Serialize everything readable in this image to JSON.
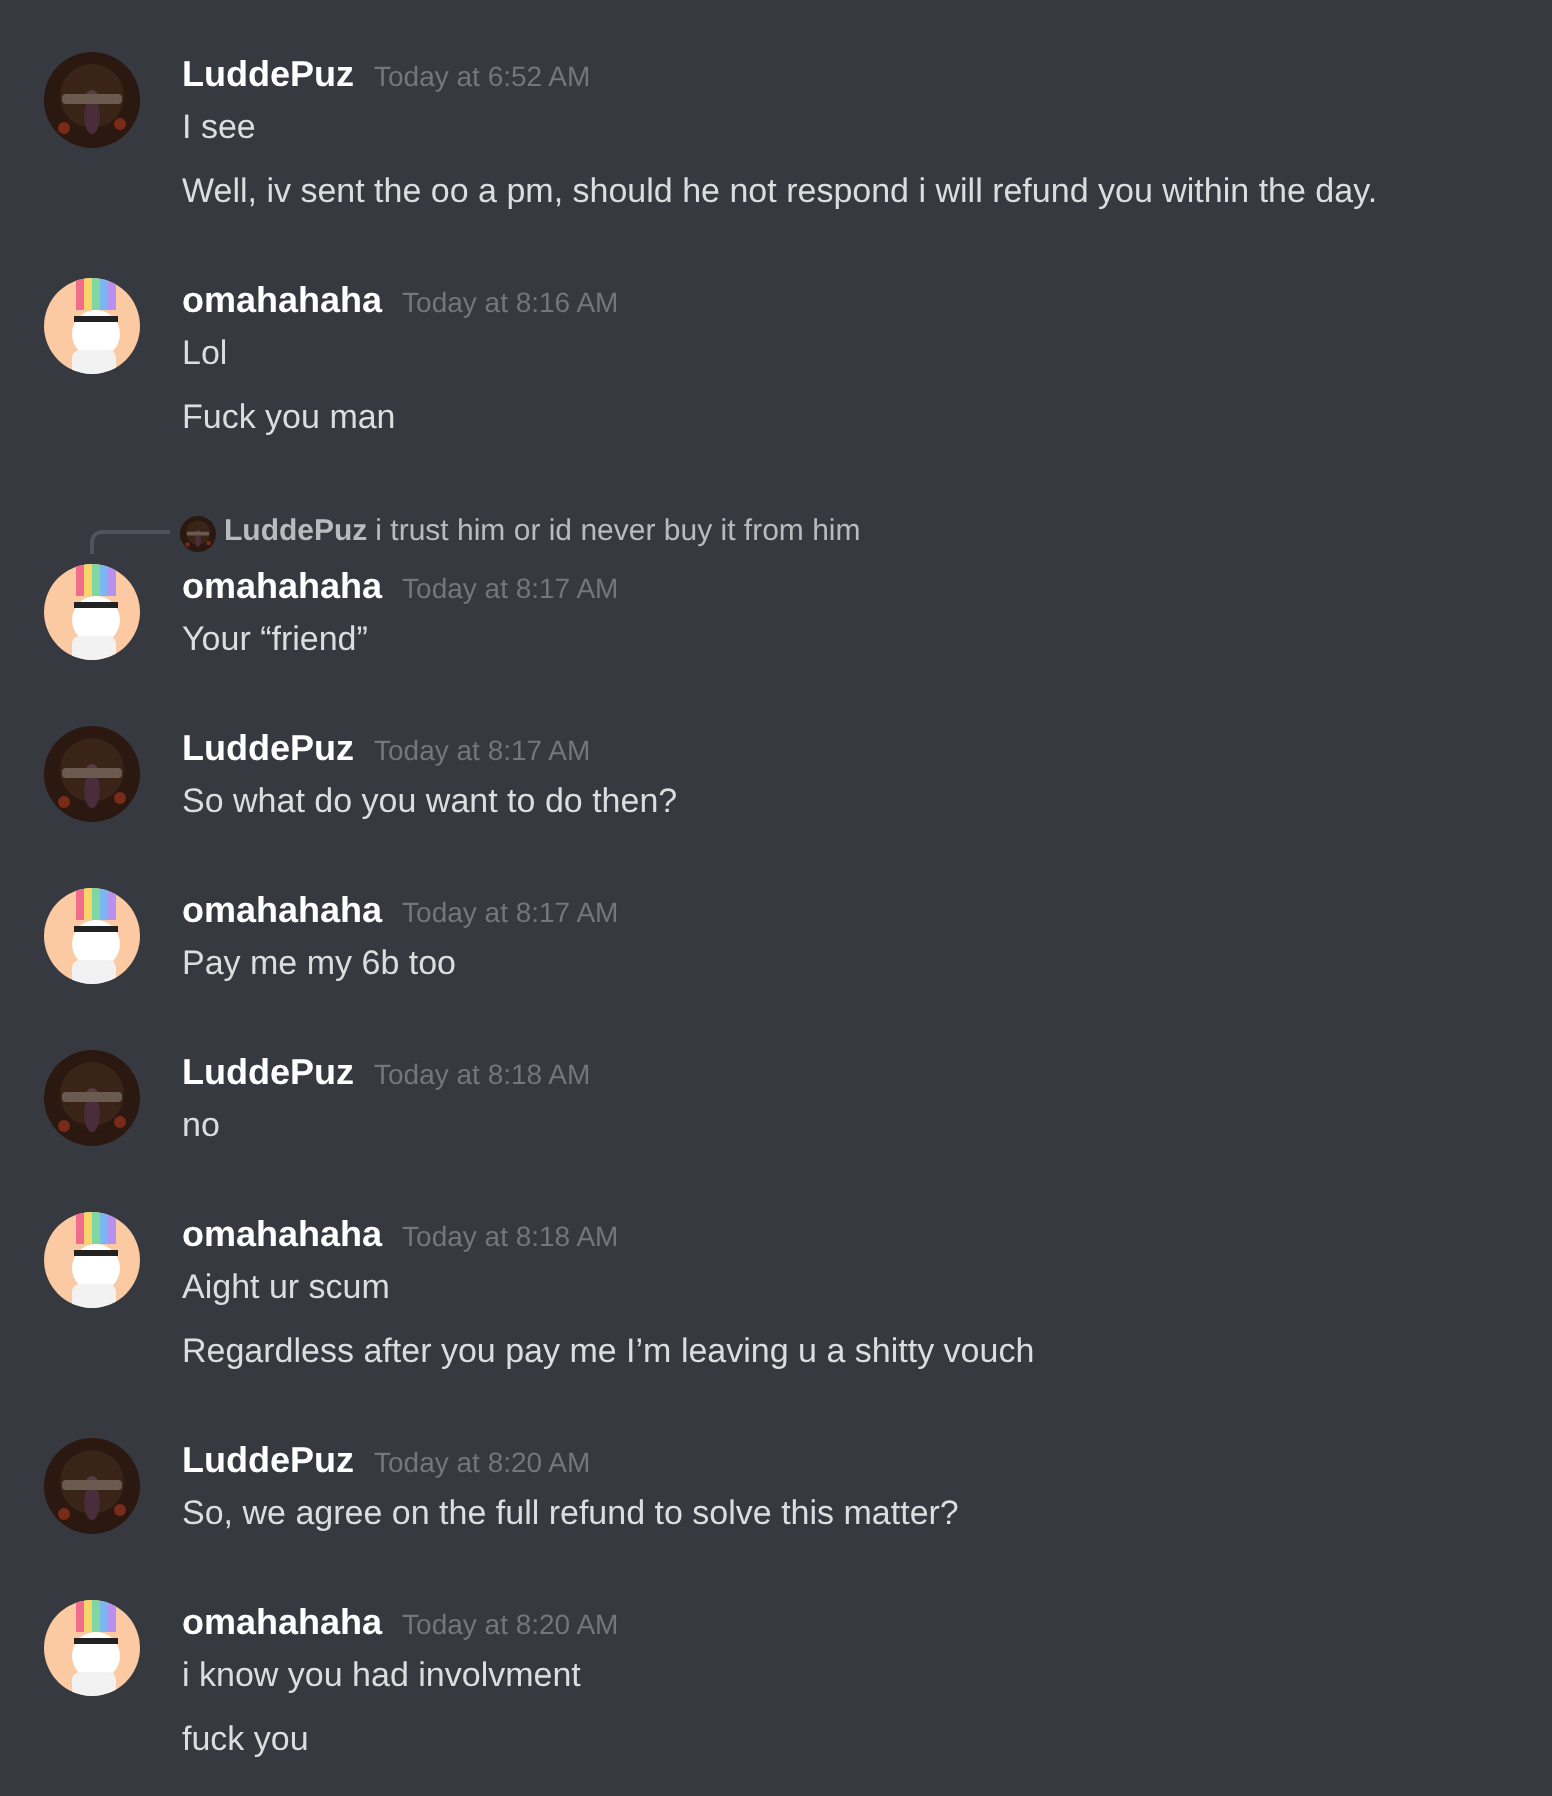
{
  "messages": [
    {
      "author": "LuddePuz",
      "kind": "dark",
      "timestamp": "Today at 6:52 AM",
      "lines": [
        "I see",
        "Well, iv sent the oo a pm, should he not respond i will refund you within the day."
      ]
    },
    {
      "author": "omahahaha",
      "kind": "light",
      "timestamp": "Today at 8:16 AM",
      "lines": [
        "Lol",
        "Fuck you man"
      ]
    },
    {
      "author": "omahahaha",
      "kind": "light",
      "timestamp": "Today at 8:17 AM",
      "reply": {
        "author": "LuddePuz",
        "kind": "dark",
        "text": "i trust him or id never buy it from him"
      },
      "lines": [
        "Your “friend”"
      ]
    },
    {
      "author": "LuddePuz",
      "kind": "dark",
      "timestamp": "Today at 8:17 AM",
      "lines": [
        "So what do you want to do then?"
      ]
    },
    {
      "author": "omahahaha",
      "kind": "light",
      "timestamp": "Today at 8:17 AM",
      "lines": [
        "Pay me my 6b too"
      ]
    },
    {
      "author": "LuddePuz",
      "kind": "dark",
      "timestamp": "Today at 8:18 AM",
      "lines": [
        "no"
      ]
    },
    {
      "author": "omahahaha",
      "kind": "light",
      "timestamp": "Today at 8:18 AM",
      "lines": [
        "Aight ur scum",
        "Regardless after you pay me I’m leaving u a shitty vouch"
      ]
    },
    {
      "author": "LuddePuz",
      "kind": "dark",
      "timestamp": "Today at 8:20 AM",
      "lines": [
        "So, we agree on the full refund to solve this matter?"
      ]
    },
    {
      "author": "omahahaha",
      "kind": "light",
      "timestamp": "Today at 8:20 AM",
      "lines": [
        "i know you had involvment",
        "fuck you"
      ]
    }
  ]
}
